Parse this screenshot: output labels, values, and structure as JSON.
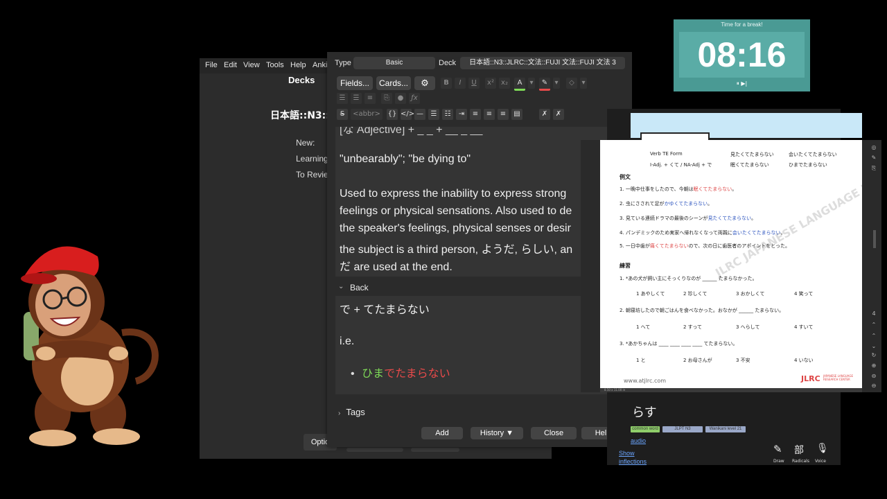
{
  "anki_main": {
    "menu": [
      "File",
      "Edit",
      "View",
      "Tools",
      "Help",
      "Anki"
    ],
    "decks_title": "Decks",
    "deck_name": "日本語::N3::",
    "stats": [
      "New:",
      "Learning",
      "To Revie"
    ],
    "options_label": "Optio"
  },
  "add_dialog": {
    "type_label": "Type",
    "type_value": "Basic",
    "deck_label": "Deck",
    "deck_value": "日本語::N3::JLRC::文法::FUJI 文法::FUJI 文法 3",
    "fields_btn": "Fields...",
    "cards_btn": "Cards...",
    "format_buttons": [
      "B",
      "I",
      "U"
    ],
    "html_tags": [
      "<abbr>",
      "{}",
      "</>"
    ],
    "front": {
      "partial_top": "[な Adjective] + _ _ + __ _ __",
      "line1": "\"unbearably\"; \"be dying to\"",
      "paragraph": [
        "Used to express the inability to express strong",
        "feelings or physical sensations. Also used to de",
        "the speaker's feelings, physical senses or desir",
        "the subject is a third person, ようだ, らしい, an",
        "だ are used at the end."
      ]
    },
    "back_label": "Back",
    "back": {
      "line1": "で + てたまらない",
      "line2": "i.e.",
      "bullet_green": "ひま",
      "bullet_red": "でたまらない"
    },
    "tags_label": "Tags",
    "footer": {
      "add": "Add",
      "history": "History ▼",
      "close": "Close",
      "help": "Help"
    }
  },
  "timer": {
    "title": "Time for a break!",
    "time": "08:16",
    "controls": "⏸ ▶|"
  },
  "pdf": {
    "header_row1": [
      "Verb TE Form",
      "見たくてたまらない",
      "会いたくてたまらない"
    ],
    "header_row2": [
      "I-Adj. + くて / NA-Adj + で",
      "眠くてたまらない",
      "ひまでたまらない"
    ],
    "examples_title": "例文",
    "examples": [
      {
        "pre": "1. 一晩中仕事をしたので、今朝は",
        "hl": "眠くてたまらない",
        "post": "。"
      },
      {
        "pre": "2. 虫にさされて足が",
        "hl": "かゆくてたまらない",
        "post": "。"
      },
      {
        "pre": "3. 見ている連続ドラマの最後のシーンが",
        "hl": "見たくてたまらない",
        "post": "。"
      },
      {
        "pre": "4. パンデミックのため実家へ帰れなくなって両親に",
        "hl": "会いたくてたまらない",
        "post": "。"
      },
      {
        "pre": "5. 一日中歯が",
        "hl": "痛くてたまらない",
        "post": "ので、次の日に歯医者のアポイントをとった。"
      }
    ],
    "practice_title": "練習",
    "q1": "1. *あの犬が飼い主にそっくりなのが ______ たまらなかった。",
    "q1_opts": [
      "1 あやしくて",
      "2 珍しくて",
      "3 おかしくて",
      "4 笑って"
    ],
    "q2": "2. 朝寝坊したので朝ごはんを食べなかった。おなかが ______ たまらない。",
    "q2_opts": [
      "1 へて",
      "2 すって",
      "3 へらして",
      "4 すいて"
    ],
    "q3": "3. *あかちゃんは ____ ____ ____ ____ てたまらない。",
    "q3_opts": [
      "1 と",
      "2 お母さんが",
      "3 不安",
      "4 いない"
    ],
    "footer_url": "www.atjlrc.com",
    "footer_logo": "JLRC",
    "footer_logo_sub": "JAPANESE LANGUAGE RESEARCH CENTER",
    "watermark": "JLRC JAPANESE LANGUAGE RESEARCH CENTER",
    "page_size": "8.50 x 11.00 in"
  },
  "jisho": {
    "word_partial": "らす",
    "tags": [
      "common word",
      "JLPT N3",
      "Wanikani level 21"
    ],
    "audio_link": "audio",
    "show_link": "Show",
    "inflections_link": "inflections",
    "tools": [
      "Draw",
      "Radicals",
      "Voice"
    ]
  },
  "colors": {
    "timer_bg": "#4a9a94",
    "accent_green": "#7ed957",
    "accent_red": "#e84a4a"
  }
}
